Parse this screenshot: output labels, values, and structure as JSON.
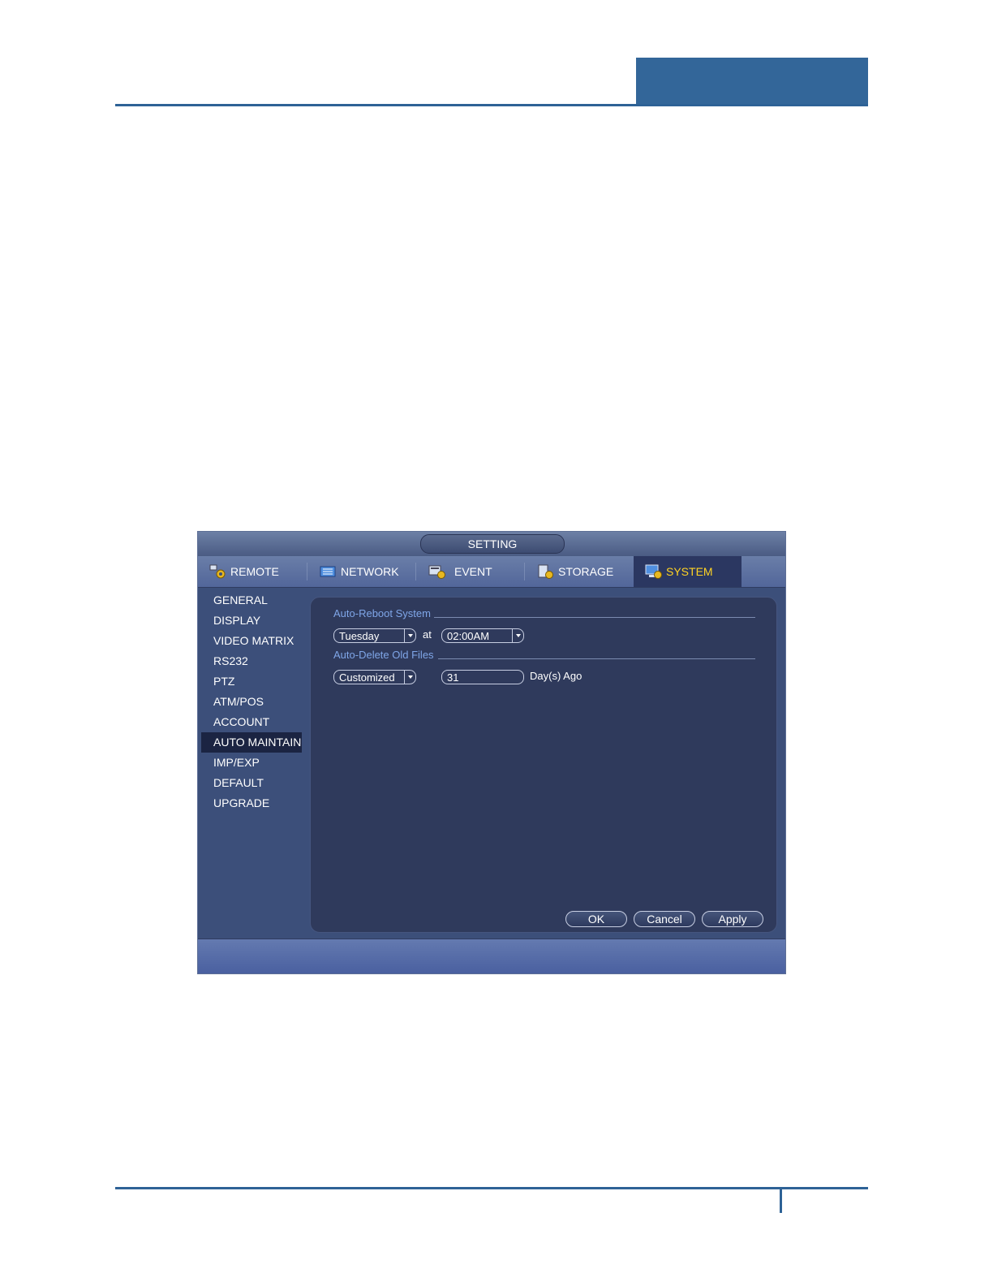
{
  "window": {
    "title": "SETTING"
  },
  "tabs": [
    {
      "label": "REMOTE",
      "icon": "remote-gear-icon"
    },
    {
      "label": "NETWORK",
      "icon": "network-icon"
    },
    {
      "label": "EVENT",
      "icon": "event-icon"
    },
    {
      "label": "STORAGE",
      "icon": "storage-icon"
    },
    {
      "label": "SYSTEM",
      "icon": "system-icon",
      "active": true
    }
  ],
  "sidebar": {
    "items": [
      {
        "label": "GENERAL"
      },
      {
        "label": "DISPLAY"
      },
      {
        "label": "VIDEO MATRIX"
      },
      {
        "label": "RS232"
      },
      {
        "label": "PTZ"
      },
      {
        "label": "ATM/POS"
      },
      {
        "label": "ACCOUNT"
      },
      {
        "label": "AUTO MAINTAIN",
        "active": true
      },
      {
        "label": "IMP/EXP"
      },
      {
        "label": "DEFAULT"
      },
      {
        "label": "UPGRADE"
      }
    ]
  },
  "auto_reboot": {
    "title": "Auto-Reboot System",
    "day": "Tuesday",
    "at_label": "at",
    "time": "02:00AM"
  },
  "auto_delete": {
    "title": "Auto-Delete Old Files",
    "mode": "Customized",
    "days": "31",
    "suffix": "Day(s) Ago"
  },
  "buttons": {
    "ok": "OK",
    "cancel": "Cancel",
    "apply": "Apply"
  },
  "colors": {
    "accent_active_tab": "#ffd323",
    "brand_blue": "#336699"
  }
}
